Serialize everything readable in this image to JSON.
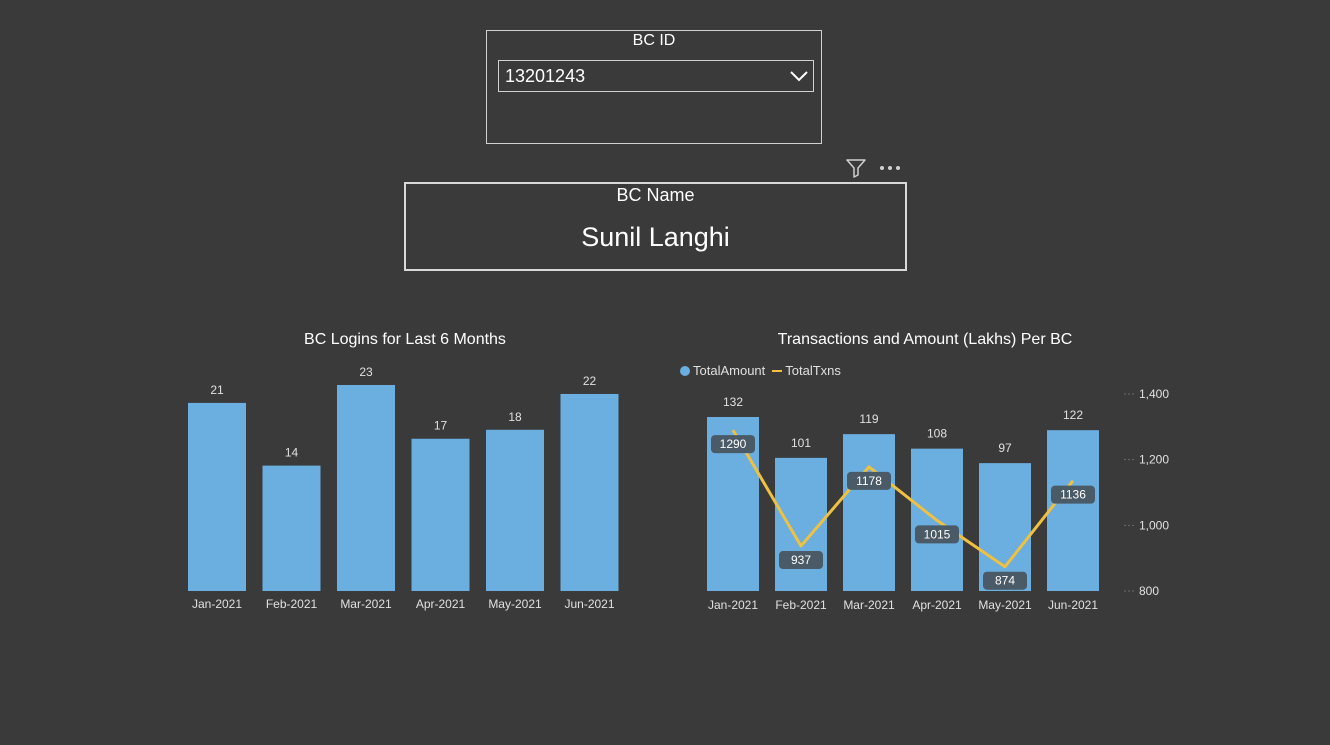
{
  "slicer": {
    "title": "BC ID",
    "selected": "13201243"
  },
  "card": {
    "title": "BC Name",
    "value": "Sunil Langhi"
  },
  "icons": {
    "filter": "filter-icon",
    "more": "more-options-icon",
    "dropdown": "chevron-down-icon"
  },
  "colors": {
    "background": "#3a3a3a",
    "bar": "#6baee0",
    "line": "#f0c040",
    "label_box": "#4a5a66"
  },
  "chart_data": [
    {
      "type": "bar",
      "title": "BC Logins for Last 6 Months",
      "categories": [
        "Jan-2021",
        "Feb-2021",
        "Mar-2021",
        "Apr-2021",
        "May-2021",
        "Jun-2021"
      ],
      "values": [
        21,
        14,
        23,
        17,
        18,
        22
      ],
      "ylim": [
        0,
        23
      ],
      "grid": false
    },
    {
      "type": "bar",
      "title": "Transactions and Amount (Lakhs) Per BC",
      "legend": [
        "TotalAmount",
        "TotalTxns"
      ],
      "legend_position": "top-left",
      "categories": [
        "Jan-2021",
        "Feb-2021",
        "Mar-2021",
        "Apr-2021",
        "May-2021",
        "Jun-2021"
      ],
      "series": [
        {
          "name": "TotalAmount",
          "type": "bar",
          "values": [
            132,
            101,
            119,
            108,
            97,
            122
          ]
        },
        {
          "name": "TotalTxns",
          "type": "line",
          "axis": "right",
          "values": [
            1290,
            937,
            1178,
            1015,
            874,
            1136
          ]
        }
      ],
      "ylim_left": [
        0,
        132
      ],
      "ylim_right": [
        800,
        1400
      ],
      "right_ticks": [
        "800",
        "1,000",
        "1,200",
        "1,400"
      ],
      "grid": false
    }
  ]
}
